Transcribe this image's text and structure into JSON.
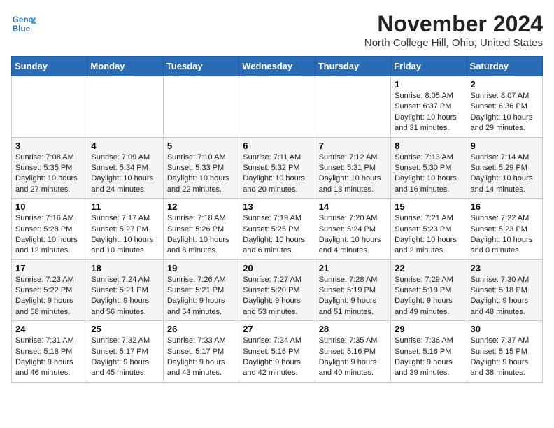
{
  "header": {
    "logo_line1": "General",
    "logo_line2": "Blue",
    "month_title": "November 2024",
    "location": "North College Hill, Ohio, United States"
  },
  "days_of_week": [
    "Sunday",
    "Monday",
    "Tuesday",
    "Wednesday",
    "Thursday",
    "Friday",
    "Saturday"
  ],
  "weeks": [
    [
      {
        "day": "",
        "info": ""
      },
      {
        "day": "",
        "info": ""
      },
      {
        "day": "",
        "info": ""
      },
      {
        "day": "",
        "info": ""
      },
      {
        "day": "",
        "info": ""
      },
      {
        "day": "1",
        "info": "Sunrise: 8:05 AM\nSunset: 6:37 PM\nDaylight: 10 hours and 31 minutes."
      },
      {
        "day": "2",
        "info": "Sunrise: 8:07 AM\nSunset: 6:36 PM\nDaylight: 10 hours and 29 minutes."
      }
    ],
    [
      {
        "day": "3",
        "info": "Sunrise: 7:08 AM\nSunset: 5:35 PM\nDaylight: 10 hours and 27 minutes."
      },
      {
        "day": "4",
        "info": "Sunrise: 7:09 AM\nSunset: 5:34 PM\nDaylight: 10 hours and 24 minutes."
      },
      {
        "day": "5",
        "info": "Sunrise: 7:10 AM\nSunset: 5:33 PM\nDaylight: 10 hours and 22 minutes."
      },
      {
        "day": "6",
        "info": "Sunrise: 7:11 AM\nSunset: 5:32 PM\nDaylight: 10 hours and 20 minutes."
      },
      {
        "day": "7",
        "info": "Sunrise: 7:12 AM\nSunset: 5:31 PM\nDaylight: 10 hours and 18 minutes."
      },
      {
        "day": "8",
        "info": "Sunrise: 7:13 AM\nSunset: 5:30 PM\nDaylight: 10 hours and 16 minutes."
      },
      {
        "day": "9",
        "info": "Sunrise: 7:14 AM\nSunset: 5:29 PM\nDaylight: 10 hours and 14 minutes."
      }
    ],
    [
      {
        "day": "10",
        "info": "Sunrise: 7:16 AM\nSunset: 5:28 PM\nDaylight: 10 hours and 12 minutes."
      },
      {
        "day": "11",
        "info": "Sunrise: 7:17 AM\nSunset: 5:27 PM\nDaylight: 10 hours and 10 minutes."
      },
      {
        "day": "12",
        "info": "Sunrise: 7:18 AM\nSunset: 5:26 PM\nDaylight: 10 hours and 8 minutes."
      },
      {
        "day": "13",
        "info": "Sunrise: 7:19 AM\nSunset: 5:25 PM\nDaylight: 10 hours and 6 minutes."
      },
      {
        "day": "14",
        "info": "Sunrise: 7:20 AM\nSunset: 5:24 PM\nDaylight: 10 hours and 4 minutes."
      },
      {
        "day": "15",
        "info": "Sunrise: 7:21 AM\nSunset: 5:23 PM\nDaylight: 10 hours and 2 minutes."
      },
      {
        "day": "16",
        "info": "Sunrise: 7:22 AM\nSunset: 5:23 PM\nDaylight: 10 hours and 0 minutes."
      }
    ],
    [
      {
        "day": "17",
        "info": "Sunrise: 7:23 AM\nSunset: 5:22 PM\nDaylight: 9 hours and 58 minutes."
      },
      {
        "day": "18",
        "info": "Sunrise: 7:24 AM\nSunset: 5:21 PM\nDaylight: 9 hours and 56 minutes."
      },
      {
        "day": "19",
        "info": "Sunrise: 7:26 AM\nSunset: 5:21 PM\nDaylight: 9 hours and 54 minutes."
      },
      {
        "day": "20",
        "info": "Sunrise: 7:27 AM\nSunset: 5:20 PM\nDaylight: 9 hours and 53 minutes."
      },
      {
        "day": "21",
        "info": "Sunrise: 7:28 AM\nSunset: 5:19 PM\nDaylight: 9 hours and 51 minutes."
      },
      {
        "day": "22",
        "info": "Sunrise: 7:29 AM\nSunset: 5:19 PM\nDaylight: 9 hours and 49 minutes."
      },
      {
        "day": "23",
        "info": "Sunrise: 7:30 AM\nSunset: 5:18 PM\nDaylight: 9 hours and 48 minutes."
      }
    ],
    [
      {
        "day": "24",
        "info": "Sunrise: 7:31 AM\nSunset: 5:18 PM\nDaylight: 9 hours and 46 minutes."
      },
      {
        "day": "25",
        "info": "Sunrise: 7:32 AM\nSunset: 5:17 PM\nDaylight: 9 hours and 45 minutes."
      },
      {
        "day": "26",
        "info": "Sunrise: 7:33 AM\nSunset: 5:17 PM\nDaylight: 9 hours and 43 minutes."
      },
      {
        "day": "27",
        "info": "Sunrise: 7:34 AM\nSunset: 5:16 PM\nDaylight: 9 hours and 42 minutes."
      },
      {
        "day": "28",
        "info": "Sunrise: 7:35 AM\nSunset: 5:16 PM\nDaylight: 9 hours and 40 minutes."
      },
      {
        "day": "29",
        "info": "Sunrise: 7:36 AM\nSunset: 5:16 PM\nDaylight: 9 hours and 39 minutes."
      },
      {
        "day": "30",
        "info": "Sunrise: 7:37 AM\nSunset: 5:15 PM\nDaylight: 9 hours and 38 minutes."
      }
    ]
  ]
}
